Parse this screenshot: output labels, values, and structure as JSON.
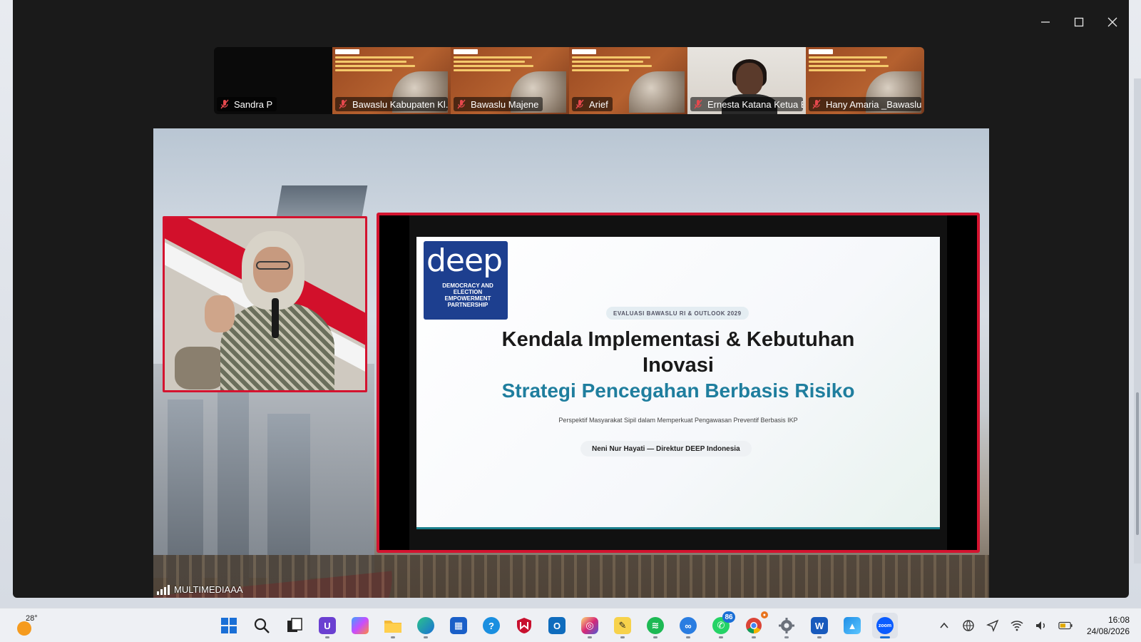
{
  "window": {
    "controls": {
      "minimize": "─",
      "maximize": "☐",
      "close": "✕"
    }
  },
  "participants": [
    {
      "name": "Sandra P",
      "kind": "dark"
    },
    {
      "name": "Bawaslu Kabupaten Kl...",
      "kind": "poster"
    },
    {
      "name": "Bawaslu Majene",
      "kind": "poster"
    },
    {
      "name": "Arief",
      "kind": "poster"
    },
    {
      "name": "Ernesta Katana Ketua B...",
      "kind": "cam"
    },
    {
      "name": "Hany Amaria _Bawaslu...",
      "kind": "poster"
    }
  ],
  "share": {
    "presenter_label": "MULTIMEDIAAA",
    "slide": {
      "logo_word": "deep",
      "logo_sub": "DEMOCRACY AND ELECTION EMPOWERMENT PARTNERSHIP",
      "tagline": "EVALUASI BAWASLU RI & OUTLOOK 2029",
      "title_line1": "Kendala Implementasi & Kebutuhan",
      "title_line2": "Inovasi",
      "title_line3": "Strategi Pencegahan Berbasis Risiko",
      "subtitle": "Perspektif Masyarakat Sipil dalam Memperkuat Pengawasan Preventif Berbasis IKP",
      "author": "Neni Nur Hayati — Direktur DEEP Indonesia"
    }
  },
  "taskbar": {
    "weather_temp": "28°",
    "whatsapp_badge": "86",
    "chrome_badge": "●",
    "clock_time": "16:08",
    "clock_date": "24/08/2026"
  },
  "colors": {
    "accent_red": "#d4132f",
    "slide_title_blue": "#1f7e9e",
    "logo_blue": "#1d3f8f",
    "windows_blue": "#1a6fd6"
  }
}
